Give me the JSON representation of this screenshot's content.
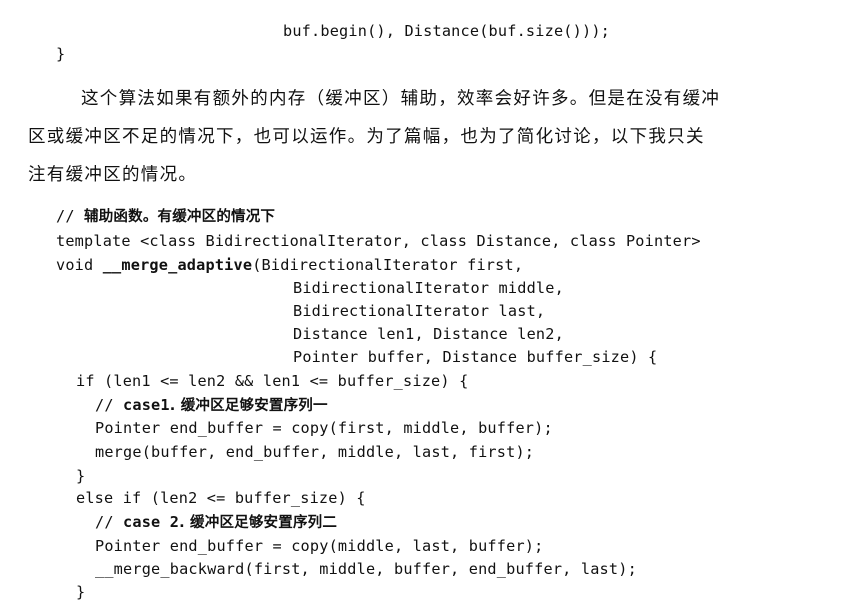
{
  "page": {
    "code_top": {
      "line1": "buf.begin(), Distance(buf.size()));",
      "line2": "}"
    },
    "prose": {
      "line1": "这个算法如果有额外的内存（缓冲区）辅助，效率会好许多。但是在没有缓冲",
      "line2": "区或缓冲区不足的情况下，也可以运作。为了篇幅，也为了简化讨论，以下我只关",
      "line3": "注有缓冲区的情况。"
    },
    "code_main": {
      "comment_prefix": "// ",
      "comment_text": "辅助函数。有缓冲区的情况下",
      "template_line": "template <class BidirectionalIterator, class Distance, class Pointer>",
      "void_prefix": "void ",
      "func_name": "__merge_adaptive",
      "sig_line1_rest": "(BidirectionalIterator first,",
      "sig_line2": "BidirectionalIterator middle,",
      "sig_line3": "BidirectionalIterator last,",
      "sig_line4": "Distance len1, Distance len2,",
      "sig_line5": "Pointer buffer, Distance buffer_size) {",
      "if_line": "if (len1 <= len2 && len1 <= buffer_size) {",
      "case1_comment_prefix": "// ",
      "case1_label": "case1",
      "case1_text": ". 缓冲区足够安置序列一",
      "case1_stmt1": "Pointer end_buffer = copy(first, middle, buffer);",
      "case1_stmt2": "merge(buffer, end_buffer, middle, last, first);",
      "close_brace_1": "}",
      "else_line": "else if (len2 <= buffer_size) {",
      "case2_comment_prefix": "// ",
      "case2_label": "case 2",
      "case2_text": ". 缓冲区足够安置序列二",
      "case2_stmt1": "Pointer end_buffer = copy(middle, last, buffer);",
      "case2_stmt2": "__merge_backward(first, middle, buffer, end_buffer, last);",
      "close_brace_2": "}"
    }
  }
}
